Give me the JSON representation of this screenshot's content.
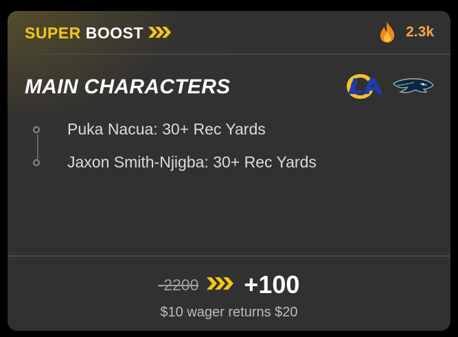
{
  "header": {
    "boost_super": "SUPER",
    "boost_word": "BOOST",
    "chevron_icon": "triple-chevron-right-icon",
    "flame_icon": "flame-icon",
    "popularity": "2.3k"
  },
  "title": "MAIN CHARACTERS",
  "teams": [
    {
      "logo": "rams-logo"
    },
    {
      "logo": "seahawks-logo"
    }
  ],
  "legs": [
    {
      "label": "Puka Nacua: 30+ Rec Yards"
    },
    {
      "label": "Jaxon Smith-Njigba: 30+ Rec Yards"
    }
  ],
  "footer": {
    "old_odds": "-2200",
    "new_odds": "+100",
    "wager_text": "$10 wager returns $20"
  },
  "colors": {
    "accent_yellow": "#f5c518",
    "popularity_orange": "#f3a64a",
    "card_bg": "#313131",
    "rams_blue": "#1f3bb3",
    "rams_gold": "#f2c230",
    "seahawks_navy": "#0b2547",
    "seahawks_green": "#6ab84b"
  }
}
